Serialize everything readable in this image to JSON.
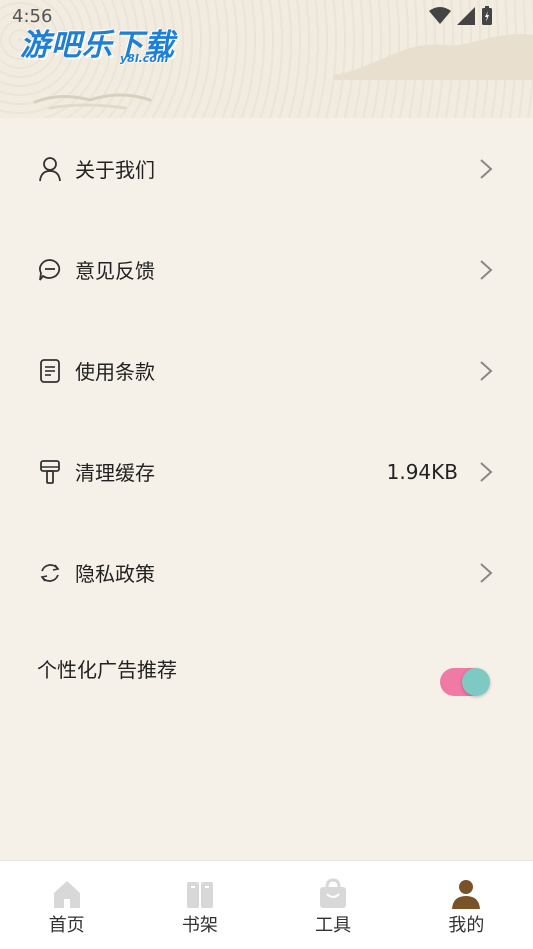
{
  "status_bar": {
    "time": "4:56"
  },
  "brand": {
    "logo_text": "游吧乐下载",
    "logo_sub": "y8l.com"
  },
  "menu": [
    {
      "label": "关于我们",
      "icon": "user-icon"
    },
    {
      "label": "意见反馈",
      "icon": "chat-bubble-icon"
    },
    {
      "label": "使用条款",
      "icon": "document-icon"
    },
    {
      "label": "清理缓存",
      "icon": "broom-icon",
      "value": "1.94KB"
    },
    {
      "label": "隐私政策",
      "icon": "refresh-icon"
    }
  ],
  "ad_setting": {
    "label": "个性化广告推荐",
    "enabled": true
  },
  "tabs": [
    {
      "label": "首页",
      "icon": "home-icon",
      "active": false
    },
    {
      "label": "书架",
      "icon": "books-icon",
      "active": false
    },
    {
      "label": "工具",
      "icon": "bag-icon",
      "active": false
    },
    {
      "label": "我的",
      "icon": "profile-icon",
      "active": true
    }
  ],
  "colors": {
    "background": "#f6f1e8",
    "toggle_track": "#f07aa4",
    "toggle_knob": "#7ec9c3",
    "active_tab": "#7a5227",
    "inactive_tab": "#d8d8d8"
  }
}
